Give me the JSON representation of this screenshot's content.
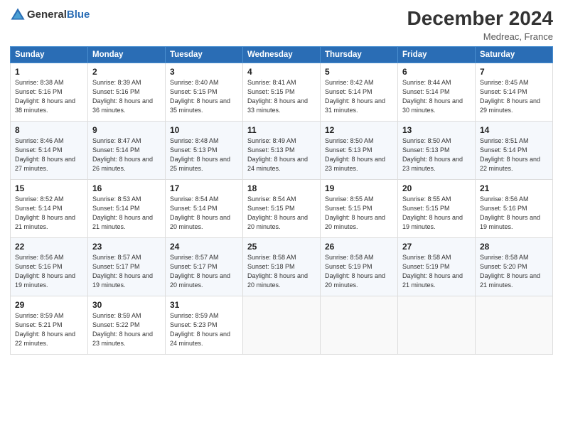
{
  "header": {
    "logo_general": "General",
    "logo_blue": "Blue",
    "month_title": "December 2024",
    "location": "Medreac, France"
  },
  "days_of_week": [
    "Sunday",
    "Monday",
    "Tuesday",
    "Wednesday",
    "Thursday",
    "Friday",
    "Saturday"
  ],
  "weeks": [
    [
      {
        "day": "1",
        "sunrise": "Sunrise: 8:38 AM",
        "sunset": "Sunset: 5:16 PM",
        "daylight": "Daylight: 8 hours and 38 minutes."
      },
      {
        "day": "2",
        "sunrise": "Sunrise: 8:39 AM",
        "sunset": "Sunset: 5:16 PM",
        "daylight": "Daylight: 8 hours and 36 minutes."
      },
      {
        "day": "3",
        "sunrise": "Sunrise: 8:40 AM",
        "sunset": "Sunset: 5:15 PM",
        "daylight": "Daylight: 8 hours and 35 minutes."
      },
      {
        "day": "4",
        "sunrise": "Sunrise: 8:41 AM",
        "sunset": "Sunset: 5:15 PM",
        "daylight": "Daylight: 8 hours and 33 minutes."
      },
      {
        "day": "5",
        "sunrise": "Sunrise: 8:42 AM",
        "sunset": "Sunset: 5:14 PM",
        "daylight": "Daylight: 8 hours and 31 minutes."
      },
      {
        "day": "6",
        "sunrise": "Sunrise: 8:44 AM",
        "sunset": "Sunset: 5:14 PM",
        "daylight": "Daylight: 8 hours and 30 minutes."
      },
      {
        "day": "7",
        "sunrise": "Sunrise: 8:45 AM",
        "sunset": "Sunset: 5:14 PM",
        "daylight": "Daylight: 8 hours and 29 minutes."
      }
    ],
    [
      {
        "day": "8",
        "sunrise": "Sunrise: 8:46 AM",
        "sunset": "Sunset: 5:14 PM",
        "daylight": "Daylight: 8 hours and 27 minutes."
      },
      {
        "day": "9",
        "sunrise": "Sunrise: 8:47 AM",
        "sunset": "Sunset: 5:14 PM",
        "daylight": "Daylight: 8 hours and 26 minutes."
      },
      {
        "day": "10",
        "sunrise": "Sunrise: 8:48 AM",
        "sunset": "Sunset: 5:13 PM",
        "daylight": "Daylight: 8 hours and 25 minutes."
      },
      {
        "day": "11",
        "sunrise": "Sunrise: 8:49 AM",
        "sunset": "Sunset: 5:13 PM",
        "daylight": "Daylight: 8 hours and 24 minutes."
      },
      {
        "day": "12",
        "sunrise": "Sunrise: 8:50 AM",
        "sunset": "Sunset: 5:13 PM",
        "daylight": "Daylight: 8 hours and 23 minutes."
      },
      {
        "day": "13",
        "sunrise": "Sunrise: 8:50 AM",
        "sunset": "Sunset: 5:13 PM",
        "daylight": "Daylight: 8 hours and 23 minutes."
      },
      {
        "day": "14",
        "sunrise": "Sunrise: 8:51 AM",
        "sunset": "Sunset: 5:14 PM",
        "daylight": "Daylight: 8 hours and 22 minutes."
      }
    ],
    [
      {
        "day": "15",
        "sunrise": "Sunrise: 8:52 AM",
        "sunset": "Sunset: 5:14 PM",
        "daylight": "Daylight: 8 hours and 21 minutes."
      },
      {
        "day": "16",
        "sunrise": "Sunrise: 8:53 AM",
        "sunset": "Sunset: 5:14 PM",
        "daylight": "Daylight: 8 hours and 21 minutes."
      },
      {
        "day": "17",
        "sunrise": "Sunrise: 8:54 AM",
        "sunset": "Sunset: 5:14 PM",
        "daylight": "Daylight: 8 hours and 20 minutes."
      },
      {
        "day": "18",
        "sunrise": "Sunrise: 8:54 AM",
        "sunset": "Sunset: 5:15 PM",
        "daylight": "Daylight: 8 hours and 20 minutes."
      },
      {
        "day": "19",
        "sunrise": "Sunrise: 8:55 AM",
        "sunset": "Sunset: 5:15 PM",
        "daylight": "Daylight: 8 hours and 20 minutes."
      },
      {
        "day": "20",
        "sunrise": "Sunrise: 8:55 AM",
        "sunset": "Sunset: 5:15 PM",
        "daylight": "Daylight: 8 hours and 19 minutes."
      },
      {
        "day": "21",
        "sunrise": "Sunrise: 8:56 AM",
        "sunset": "Sunset: 5:16 PM",
        "daylight": "Daylight: 8 hours and 19 minutes."
      }
    ],
    [
      {
        "day": "22",
        "sunrise": "Sunrise: 8:56 AM",
        "sunset": "Sunset: 5:16 PM",
        "daylight": "Daylight: 8 hours and 19 minutes."
      },
      {
        "day": "23",
        "sunrise": "Sunrise: 8:57 AM",
        "sunset": "Sunset: 5:17 PM",
        "daylight": "Daylight: 8 hours and 19 minutes."
      },
      {
        "day": "24",
        "sunrise": "Sunrise: 8:57 AM",
        "sunset": "Sunset: 5:17 PM",
        "daylight": "Daylight: 8 hours and 20 minutes."
      },
      {
        "day": "25",
        "sunrise": "Sunrise: 8:58 AM",
        "sunset": "Sunset: 5:18 PM",
        "daylight": "Daylight: 8 hours and 20 minutes."
      },
      {
        "day": "26",
        "sunrise": "Sunrise: 8:58 AM",
        "sunset": "Sunset: 5:19 PM",
        "daylight": "Daylight: 8 hours and 20 minutes."
      },
      {
        "day": "27",
        "sunrise": "Sunrise: 8:58 AM",
        "sunset": "Sunset: 5:19 PM",
        "daylight": "Daylight: 8 hours and 21 minutes."
      },
      {
        "day": "28",
        "sunrise": "Sunrise: 8:58 AM",
        "sunset": "Sunset: 5:20 PM",
        "daylight": "Daylight: 8 hours and 21 minutes."
      }
    ],
    [
      {
        "day": "29",
        "sunrise": "Sunrise: 8:59 AM",
        "sunset": "Sunset: 5:21 PM",
        "daylight": "Daylight: 8 hours and 22 minutes."
      },
      {
        "day": "30",
        "sunrise": "Sunrise: 8:59 AM",
        "sunset": "Sunset: 5:22 PM",
        "daylight": "Daylight: 8 hours and 23 minutes."
      },
      {
        "day": "31",
        "sunrise": "Sunrise: 8:59 AM",
        "sunset": "Sunset: 5:23 PM",
        "daylight": "Daylight: 8 hours and 24 minutes."
      },
      null,
      null,
      null,
      null
    ]
  ]
}
